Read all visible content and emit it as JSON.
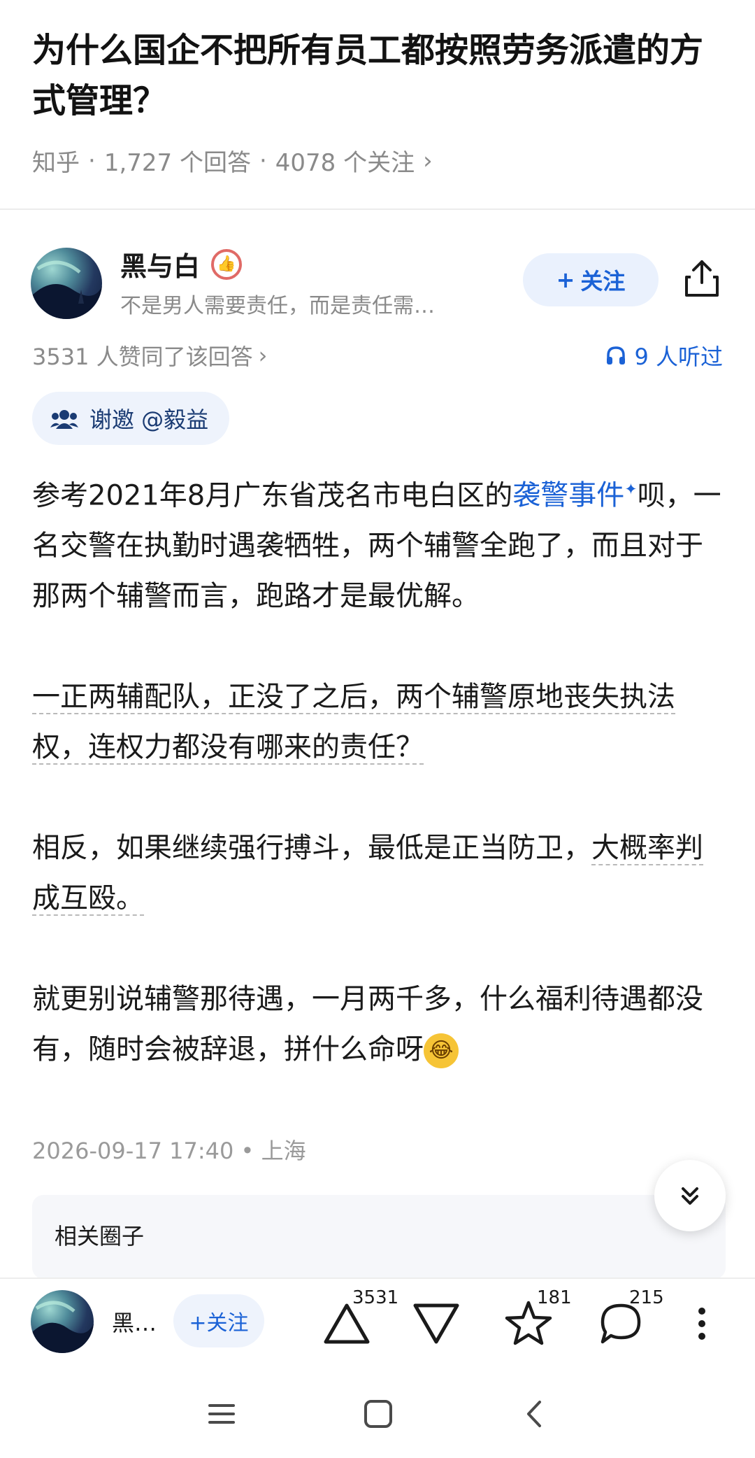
{
  "question": {
    "title": "为什么国企不把所有员工都按照劳务派遣的方式管理？",
    "source": "知乎",
    "answers_count": "1,727 个回答",
    "followers_count": "4078 个关注",
    "sep": "·",
    "chevron": "›"
  },
  "author": {
    "name": "黑与白",
    "bio": "不是男人需要责任，而是责任需…",
    "follow_label": "关注",
    "follow_plus": "+"
  },
  "stats": {
    "upvote_text": "3531 人赞同了该回答",
    "listen_text": "9 人听过"
  },
  "invite": {
    "text": "谢邀 @毅益"
  },
  "answer": {
    "p1_before": "参考2021年8月广东省茂名市电白区的",
    "p1_link": "袭警事件",
    "p1_sup": "✦",
    "p1_after": "呗，一名交警在执勤时遇袭牺牲，两个辅警全跑了，而且对于那两个辅警而言，跑路才是最优解。",
    "p2": "一正两辅配队，正没了之后，两个辅警原地丧失执法权，连权力都没有哪来的责任？",
    "p3_before": "相反，如果继续强行搏斗，最低是正当防卫，",
    "p3_dashed": "大概率判成互殴。",
    "p4": "就更别说辅警那待遇，一月两千多，什么福利待遇都没有，随时会被辞退，拼什么命呀"
  },
  "footer": {
    "timestamp": "2026-09-17 17:40 • 上海",
    "related_label": "相关圈子"
  },
  "action_bar": {
    "author_short": "黑…",
    "follow_label": "+关注",
    "upvote_count": "3531",
    "star_count": "181",
    "comment_count": "215"
  },
  "icons": [
    "share-icon",
    "headphones-icon",
    "invite-icon",
    "chevron-double-down-icon",
    "upvote-icon",
    "downvote-icon",
    "star-icon",
    "comment-icon",
    "more-icon",
    "menu-icon",
    "home-icon",
    "back-icon"
  ],
  "colors": {
    "accent": "#1b62d6",
    "muted": "#8a8a8a",
    "chip_bg": "#eef3fc"
  }
}
